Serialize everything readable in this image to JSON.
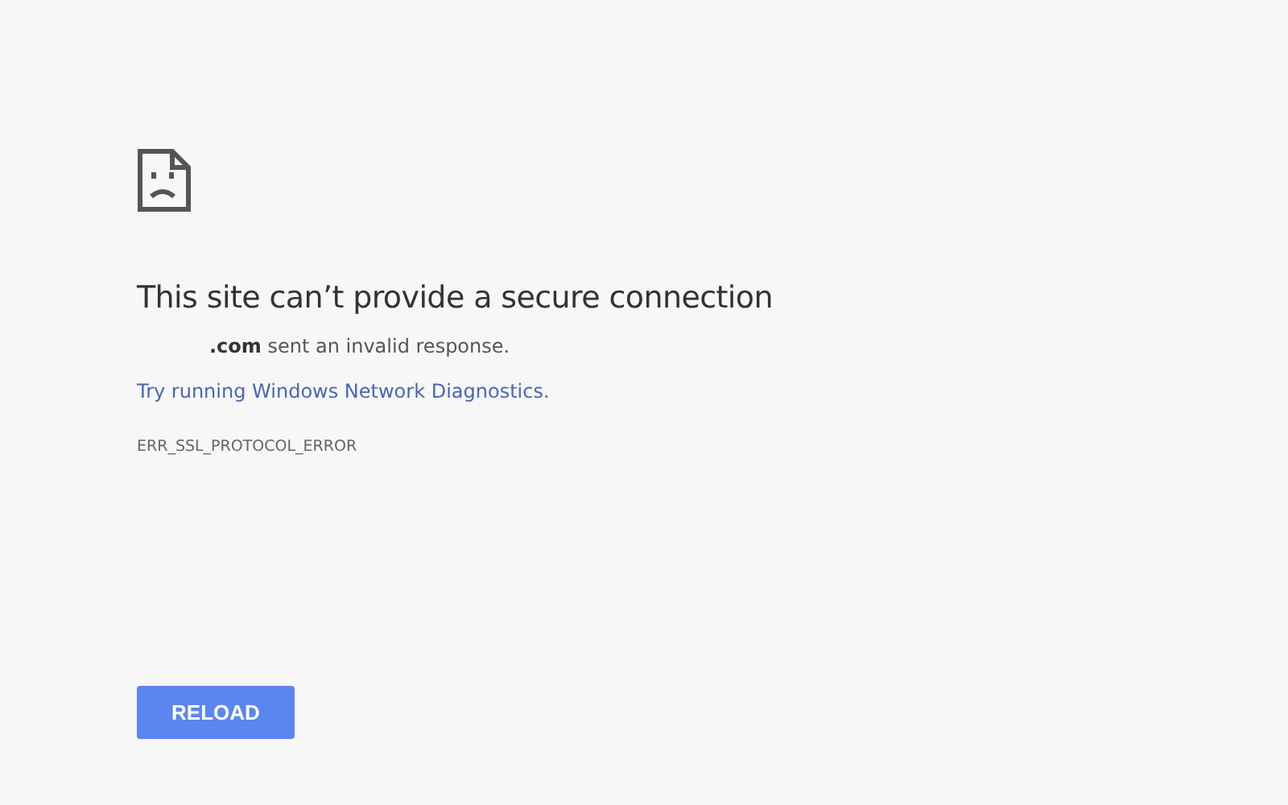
{
  "error_page": {
    "title": "This site can’t provide a secure connection",
    "description": "**.com** sent an invalid response.",
    "suggestion_link": "Try running Windows Network Diagnostics.",
    "error_code": "ERR_SSL_PROTOCOL_ERROR",
    "buttons": [
      "RELOAD"
    ]
  }
}
